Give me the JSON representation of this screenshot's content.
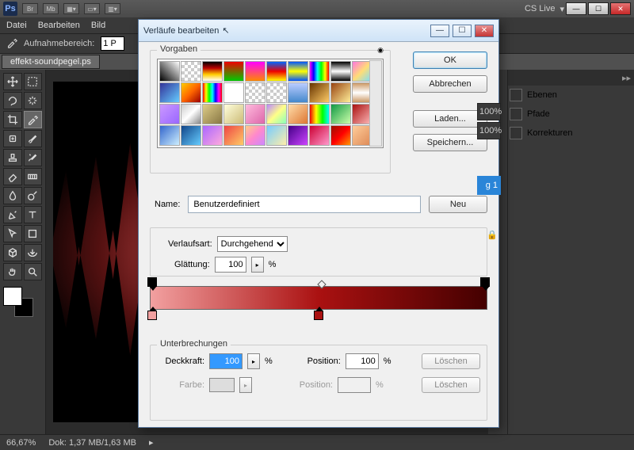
{
  "app": {
    "cs_live": "CS Live"
  },
  "menu": {
    "file": "Datei",
    "edit": "Bearbeiten",
    "image": "Bild"
  },
  "options": {
    "sample_label": "Aufnahmebereich:",
    "sample_value": "1 P"
  },
  "doc_tab": "effekt-soundpegel.ps",
  "status": {
    "zoom": "66,67%",
    "doc": "Dok: 1,37 MB/1,63 MB"
  },
  "panels": {
    "ebenen": "Ebenen",
    "pfade": "Pfade",
    "korrekturen": "Korrekturen",
    "opacity": "100%",
    "layer_suffix": "g 1"
  },
  "dialog": {
    "title": "Verläufe bearbeiten",
    "presets": "Vorgaben",
    "ok": "OK",
    "cancel": "Abbrechen",
    "load": "Laden...",
    "save": "Speichern...",
    "name_label": "Name:",
    "name_value": "Benutzerdefiniert",
    "new": "Neu",
    "type_label": "Verlaufsart:",
    "type_value": "Durchgehend",
    "smooth_label": "Glättung:",
    "smooth_value": "100",
    "percent": "%",
    "breaks": "Unterbrechungen",
    "opacity_label": "Deckkraft:",
    "opacity_value": "100",
    "position_label": "Position:",
    "position_value": "100",
    "color_label": "Farbe:",
    "delete": "Löschen"
  }
}
